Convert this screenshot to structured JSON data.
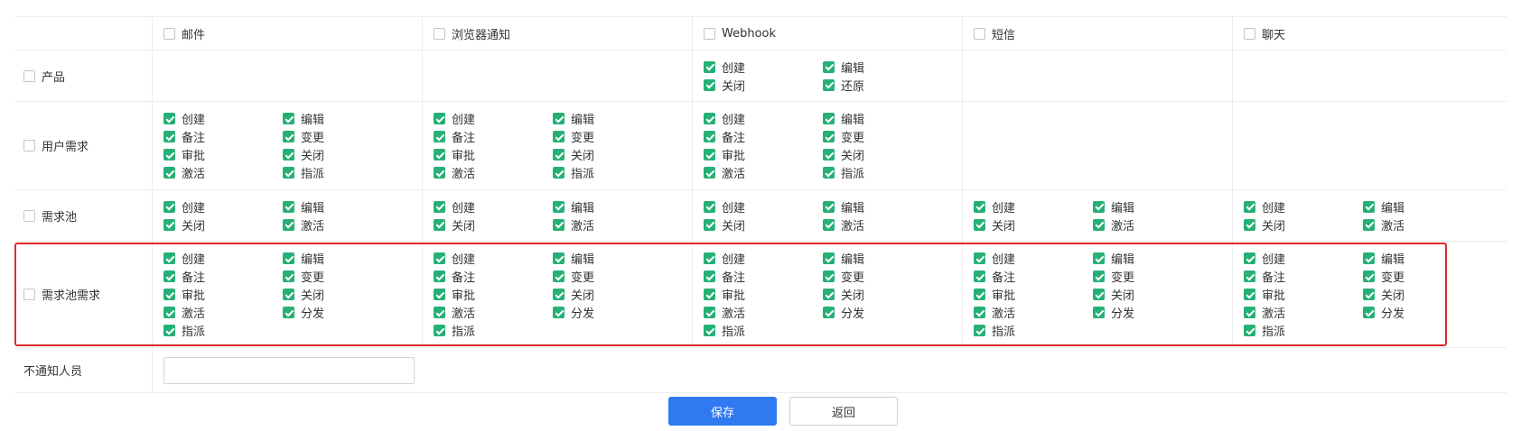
{
  "channels": [
    "邮件",
    "浏览器通知",
    "Webhook",
    "短信",
    "聊天"
  ],
  "rows": [
    {
      "label": "产品",
      "cells": [
        [],
        [],
        [
          "创建",
          "编辑",
          "关闭",
          "还原"
        ],
        [],
        []
      ]
    },
    {
      "label": "用户需求",
      "cells": [
        [
          "创建",
          "编辑",
          "备注",
          "变更",
          "审批",
          "关闭",
          "激活",
          "指派"
        ],
        [
          "创建",
          "编辑",
          "备注",
          "变更",
          "审批",
          "关闭",
          "激活",
          "指派"
        ],
        [
          "创建",
          "编辑",
          "备注",
          "变更",
          "审批",
          "关闭",
          "激活",
          "指派"
        ],
        [],
        []
      ]
    },
    {
      "label": "需求池",
      "cells": [
        [
          "创建",
          "编辑",
          "关闭",
          "激活"
        ],
        [
          "创建",
          "编辑",
          "关闭",
          "激活"
        ],
        [
          "创建",
          "编辑",
          "关闭",
          "激活"
        ],
        [
          "创建",
          "编辑",
          "关闭",
          "激活"
        ],
        [
          "创建",
          "编辑",
          "关闭",
          "激活"
        ]
      ]
    },
    {
      "label": "需求池需求",
      "cells": [
        [
          "创建",
          "编辑",
          "备注",
          "变更",
          "审批",
          "关闭",
          "激活",
          "分发",
          "指派"
        ],
        [
          "创建",
          "编辑",
          "备注",
          "变更",
          "审批",
          "关闭",
          "激活",
          "分发",
          "指派"
        ],
        [
          "创建",
          "编辑",
          "备注",
          "变更",
          "审批",
          "关闭",
          "激活",
          "分发",
          "指派"
        ],
        [
          "创建",
          "编辑",
          "备注",
          "变更",
          "审批",
          "关闭",
          "激活",
          "分发",
          "指派"
        ],
        [
          "创建",
          "编辑",
          "备注",
          "变更",
          "审批",
          "关闭",
          "激活",
          "分发",
          "指派"
        ]
      ]
    }
  ],
  "no_notify": {
    "label": "不通知人员",
    "value": "",
    "placeholder": ""
  },
  "buttons": {
    "save": "保存",
    "back": "返回"
  },
  "colors": {
    "checked": "#26b075",
    "primary_button": "#2f7af0",
    "highlight": "#e02b27"
  }
}
